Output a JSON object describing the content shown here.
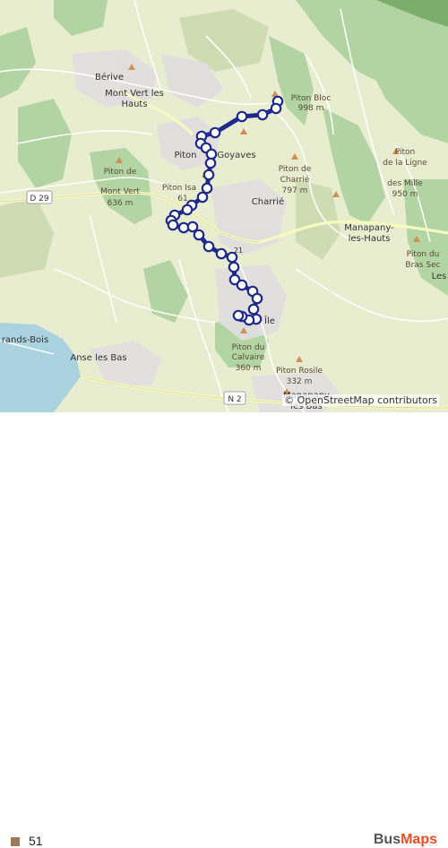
{
  "map": {
    "places": [
      {
        "id": "berive",
        "text": "Bérive"
      },
      {
        "id": "mont-vert-les-hauts-1",
        "text": "Mont Vert les"
      },
      {
        "id": "mont-vert-les-hauts-2",
        "text": "Hauts"
      },
      {
        "id": "piton-goyaves-1",
        "text": "Piton"
      },
      {
        "id": "piton-goyaves-2",
        "text": "Goyaves"
      },
      {
        "id": "charrie",
        "text": "Charrié"
      },
      {
        "id": "manapany-les-hauts-1",
        "text": "Manapany-"
      },
      {
        "id": "manapany-les-hauts-2",
        "text": "les-Hauts"
      },
      {
        "id": "les-partial",
        "text": "Les"
      },
      {
        "id": "saint-pierre-partial",
        "text": "Île"
      },
      {
        "id": "grands-bois",
        "text": "rands-Bois"
      },
      {
        "id": "anse-les-bas",
        "text": "Anse les Bas"
      },
      {
        "id": "manapany-les-bas-1",
        "text": "Manapany"
      },
      {
        "id": "manapany-les-bas-2",
        "text": "les Bas"
      }
    ],
    "peaks": [
      {
        "id": "piton-bloc",
        "lines": [
          "Piton Bloc",
          "998 m"
        ]
      },
      {
        "id": "piton-mont-vert",
        "lines": [
          "Piton de",
          "Mont Vert",
          "636 m"
        ]
      },
      {
        "id": "piton-isa",
        "lines": [
          "Piton Isa",
          "61"
        ]
      },
      {
        "id": "piton-charrie",
        "lines": [
          "Piton de",
          "Charrié",
          "797 m"
        ]
      },
      {
        "id": "piton-ligne-milles",
        "lines": [
          "Piton",
          "de la Ligne",
          "des Mille",
          "950 m"
        ]
      },
      {
        "id": "piton-bras-sec",
        "lines": [
          "Piton du",
          "Bras Sec"
        ]
      },
      {
        "id": "piton-calvaire",
        "lines": [
          "Piton du",
          "Calvaire",
          "360 m"
        ]
      },
      {
        "id": "piton-rosile",
        "lines": [
          "Piton Rosile",
          "332 m"
        ]
      }
    ],
    "roads": [
      {
        "id": "d29",
        "text": "D 29"
      },
      {
        "id": "n2",
        "text": "N 2"
      },
      {
        "id": "d21",
        "text": "21"
      }
    ],
    "attribution": "© OpenStreetMap contributors"
  },
  "legend": {
    "line_number": "51",
    "line_color": "#9b7a5c",
    "route_color": "#1e2a8c"
  },
  "brand": {
    "part1": "Bus",
    "part2": "Maps"
  }
}
